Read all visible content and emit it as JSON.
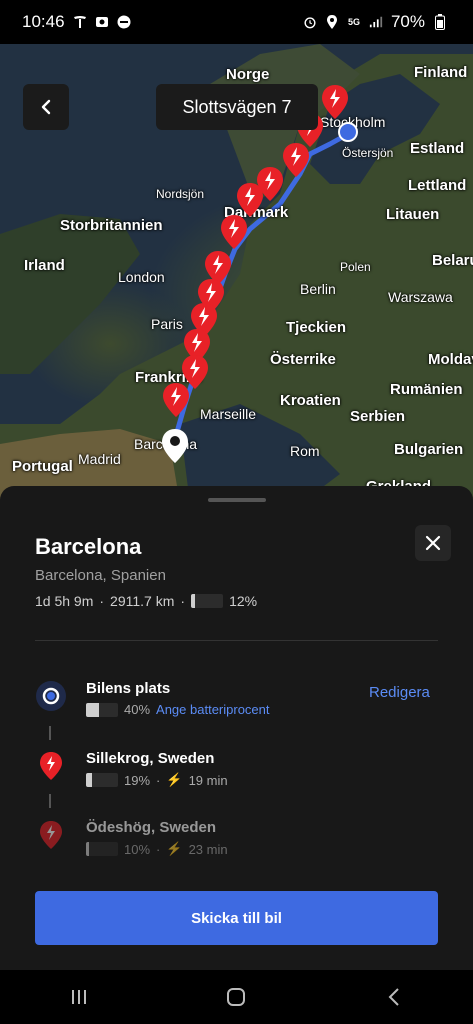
{
  "status_bar": {
    "time": "10:46",
    "battery": "70%",
    "network": "5G"
  },
  "map": {
    "labels": {
      "norge": "Norge",
      "finland": "Finland",
      "stockholm": "Stockholm",
      "ostersjon": "Östersjön",
      "estland": "Estland",
      "nordsjon": "Nordsjön",
      "lettland": "Lettland",
      "storbritannien": "Storbritannien",
      "danmark": "Danmark",
      "litauen": "Litauen",
      "irland": "Irland",
      "london": "London",
      "polen": "Polen",
      "belarus": "Belarus",
      "berlin": "Berlin",
      "warszawa": "Warszawa",
      "paris": "Paris",
      "tjeckien": "Tjeckien",
      "frankrike": "Frankrike",
      "osterrike": "Österrike",
      "moldavien": "Moldavien",
      "rumanien": "Rumänien",
      "marseille": "Marseille",
      "kroatien": "Kroatien",
      "serbien": "Serbien",
      "barcelona": "Barcelona",
      "rom": "Rom",
      "bulgarien": "Bulgarien",
      "portugal": "Portugal",
      "madrid": "Madrid",
      "grekland": "Grekland"
    },
    "route_color": "#3e6ae1",
    "charger_color": "#e82127"
  },
  "header": {
    "address": "Slottsvägen 7"
  },
  "destination": {
    "title": "Barcelona",
    "subtitle": "Barcelona, Spanien",
    "duration": "1d 5h 9m",
    "distance": "2911.7 km",
    "arrival_battery": "12%",
    "arrival_battery_level": 0.12
  },
  "stops": [
    {
      "name": "Bilens plats",
      "battery": "40%",
      "battery_level": 0.4,
      "link": "Ange batteriprocent",
      "action": "Redigera"
    },
    {
      "name": "Sillekrog, Sweden",
      "battery": "19%",
      "battery_level": 0.19,
      "charge_time": "19 min"
    },
    {
      "name": "Ödeshög, Sweden",
      "battery": "10%",
      "battery_level": 0.1,
      "charge_time": "23 min"
    }
  ],
  "send_button": "Skicka till bil"
}
